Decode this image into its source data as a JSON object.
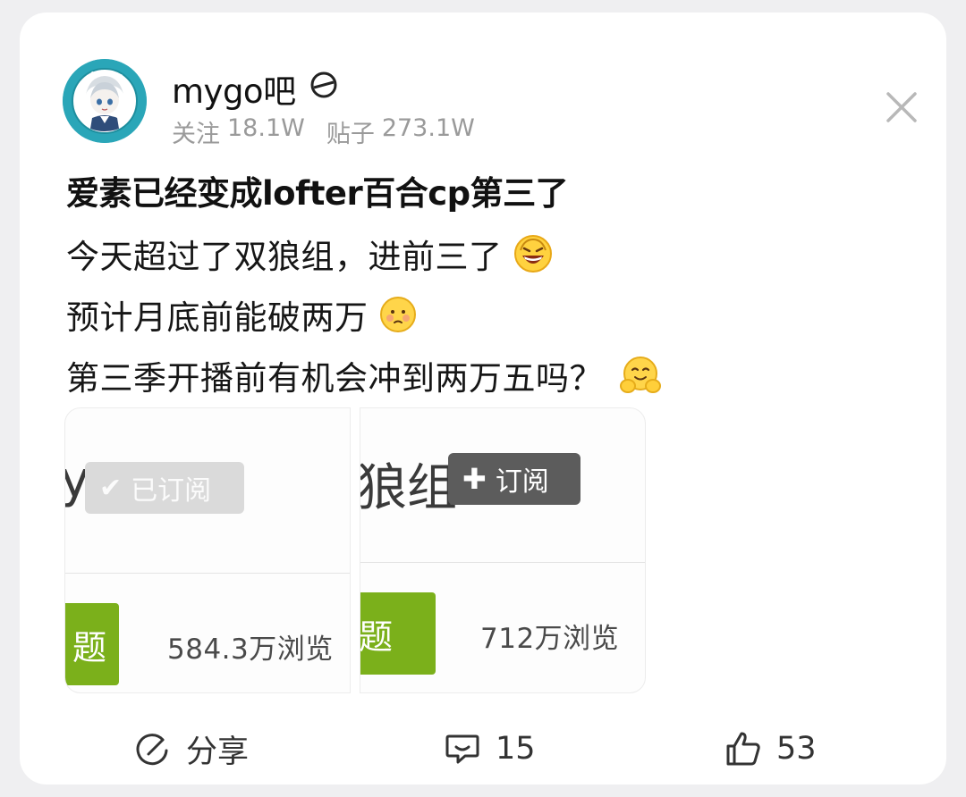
{
  "forum": {
    "name": "mygo吧",
    "followers_label": "关注",
    "followers": "18.1W",
    "posts_label": "贴子",
    "posts": "273.1W"
  },
  "post": {
    "title": "爱素已经变成lofter百合cp第三了",
    "lines": [
      "今天超过了双狼组，进前三了",
      "预计月底前能破两万",
      "第三季开播前有机会冲到两万五吗？"
    ]
  },
  "images": [
    {
      "heading": "y",
      "button_label": "已订阅",
      "tag_text": "题",
      "views": "584.3万浏览"
    },
    {
      "heading": "狼组",
      "button_label": "订阅",
      "tag_text": "题",
      "views": "712万浏览"
    }
  ],
  "actions": {
    "share": "分享",
    "comments": "15",
    "likes": "53"
  },
  "colors": {
    "tag_green": "#7bb01b",
    "subscribed_gray": "#d9d9d9",
    "subscribe_dark": "#5c5c5c",
    "avatar_teal": "#2aa6b8"
  }
}
